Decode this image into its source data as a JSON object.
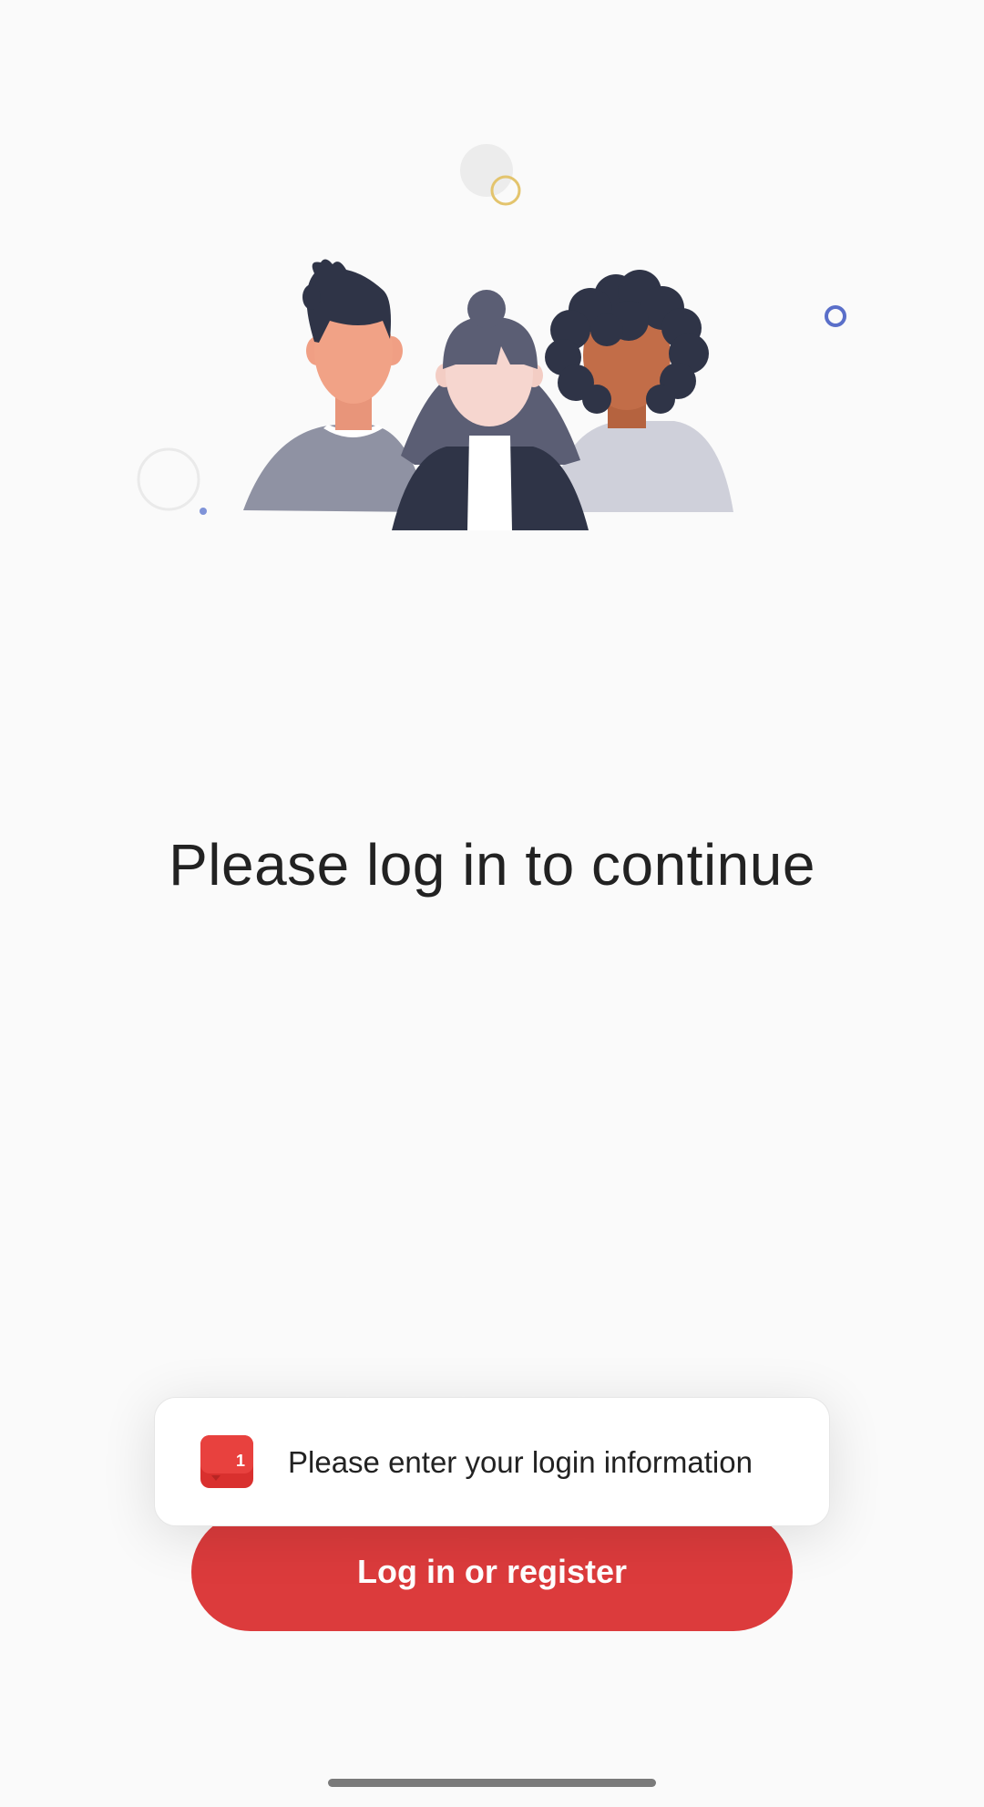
{
  "main": {
    "title": "Please log in to continue",
    "primary_button_label": "Log in or register"
  },
  "toast": {
    "badge_count": "1",
    "message": "Please enter your login information"
  },
  "illustration": {
    "subject": "three-people-group-illustration"
  },
  "colors": {
    "background": "#fafafa",
    "accent": "#dc3b3c",
    "title_text": "#222222",
    "dark_figure": "#2f3447",
    "deco_blue": "#5a6fc9",
    "deco_gold": "#e3c46d"
  },
  "system": {
    "home_indicator": "home-indicator"
  }
}
